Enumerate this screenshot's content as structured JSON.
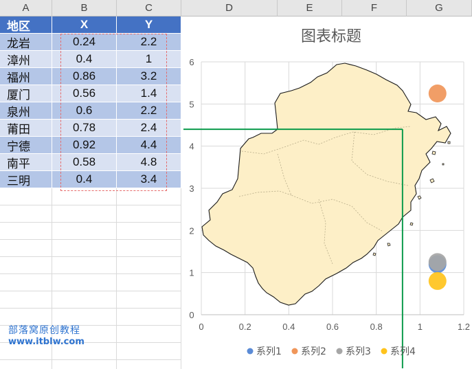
{
  "columns": [
    "A",
    "B",
    "C",
    "D",
    "E",
    "F",
    "G"
  ],
  "table": {
    "headers": [
      "地区",
      "X",
      "Y"
    ],
    "rows": [
      {
        "region": "龙岩",
        "x": "0.24",
        "y": "2.2"
      },
      {
        "region": "漳州",
        "x": "0.4",
        "y": "1"
      },
      {
        "region": "福州",
        "x": "0.86",
        "y": "3.2"
      },
      {
        "region": "厦门",
        "x": "0.56",
        "y": "1.4"
      },
      {
        "region": "泉州",
        "x": "0.6",
        "y": "2.2"
      },
      {
        "region": "莆田",
        "x": "0.78",
        "y": "2.4"
      },
      {
        "region": "宁德",
        "x": "0.92",
        "y": "4.4"
      },
      {
        "region": "南平",
        "x": "0.58",
        "y": "4.8"
      },
      {
        "region": "三明",
        "x": "0.4",
        "y": "3.4"
      }
    ]
  },
  "watermark": {
    "line1": "部落窝原创教程",
    "line2": "www.itblw.com"
  },
  "colors": {
    "header_blue": "#4472c4",
    "row_dark": "#b4c6e7",
    "row_light": "#d9e1f2",
    "dash": "#e66a6a",
    "map_fill": "#fdefc7",
    "crosshair": "#0a9a4a"
  },
  "chart_data": {
    "type": "scatter",
    "title": "图表标题",
    "xlim": [
      0,
      1.2
    ],
    "ylim": [
      0,
      6
    ],
    "x_ticks": [
      "0",
      "0.2",
      "0.4",
      "0.6",
      "0.8",
      "1",
      "1.2"
    ],
    "y_ticks": [
      "0",
      "1",
      "2",
      "3",
      "4",
      "5",
      "6"
    ],
    "grid": true,
    "legend_position": "bottom",
    "series": [
      {
        "name": "系列1",
        "color": "#5b8bd6",
        "points": [
          {
            "x": 1.08,
            "y": 1.2
          }
        ]
      },
      {
        "name": "系列2",
        "color": "#f0965a",
        "points": [
          {
            "x": 1.08,
            "y": 5.25
          }
        ]
      },
      {
        "name": "系列3",
        "color": "#a6a6a6",
        "points": [
          {
            "x": 1.08,
            "y": 1.25
          }
        ]
      },
      {
        "name": "系列4",
        "color": "#ffc31c",
        "points": [
          {
            "x": 1.08,
            "y": 0.8
          }
        ]
      }
    ],
    "crosshair": {
      "x": 0.92,
      "y": 4.4
    }
  }
}
